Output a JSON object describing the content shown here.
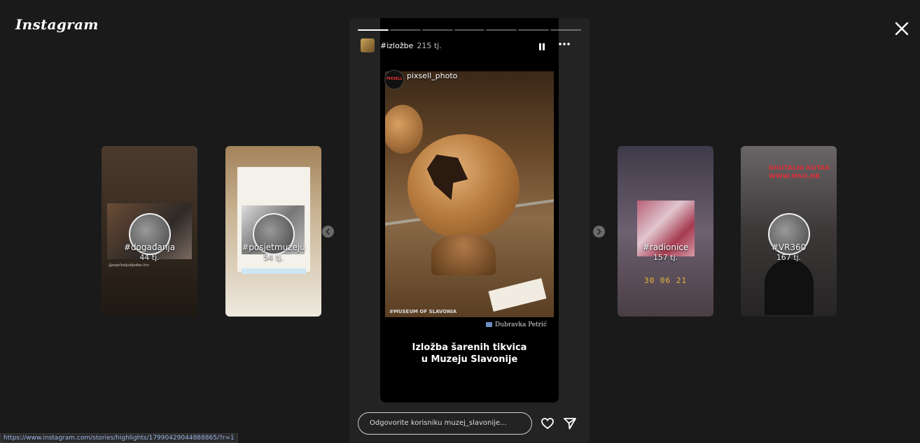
{
  "app": {
    "logo_text": "Instagram"
  },
  "previews": [
    {
      "title": "#događanja",
      "time": "44 tj.",
      "mini_caption": "@osječkoljubljeđan.hrv"
    },
    {
      "title": "#posjetmuzeju",
      "time": "54 tj."
    },
    {
      "title": "#radionice",
      "time": "157 tj.",
      "date_text": "30 06 21"
    },
    {
      "title": "#VR360",
      "time": "167 tj.",
      "sign_text": "DIGITALNI KUTAK WWW.MSO.HR"
    }
  ],
  "story": {
    "highlight_name": "#izložbe",
    "time_ago": "215 tj.",
    "progress_segments": 7,
    "active_segment": 1,
    "source_account": "pixsell_photo",
    "source_badge": "PIXSELL",
    "watermark": "#MUSEUM OF SLAVONIA",
    "photo_credit": "Dubravka Petrić",
    "caption_line1": "Izložba šarenih tikvica",
    "caption_line2": "u Muzeju Slavonije",
    "reply_placeholder": "Odgovorite korisniku muzej_slavonije..."
  },
  "status_bar": {
    "url": "https://www.instagram.com/stories/highlights/17990429044888865/?r=1"
  }
}
